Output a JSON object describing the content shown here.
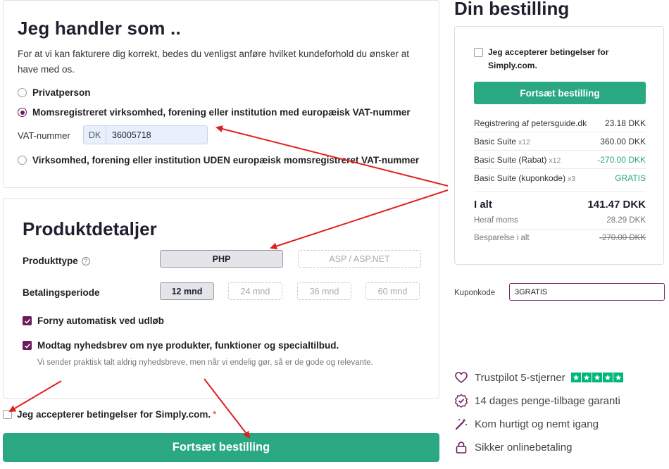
{
  "customer": {
    "title": "Jeg handler som ..",
    "description": "For at vi kan fakturere dig korrekt, bedes du venligst anføre hvilket kundeforhold du ønsker at have med os.",
    "options": [
      {
        "label": "Privatperson",
        "selected": false
      },
      {
        "label": "Momsregistreret virksomhed, forening eller institution med europæisk VAT-nummer",
        "selected": true
      },
      {
        "label": "Virksomhed, forening eller institution UDEN europæisk momsregistreret VAT-nummer",
        "selected": false
      }
    ],
    "vat_label": "VAT-nummer",
    "vat_prefix": "DK",
    "vat_value": "36005718"
  },
  "product": {
    "title": "Produktdetaljer",
    "type_label": "Produkttype",
    "types": [
      "PHP",
      "ASP / ASP.NET"
    ],
    "period_label": "Betalingsperiode",
    "periods": [
      "12 mnd",
      "24 mnd",
      "36 mnd",
      "60 mnd"
    ],
    "renew_label": "Forny automatisk ved udløb",
    "newsletter_label": "Modtag nyhedsbrev om nye produkter, funktioner og specialtilbud.",
    "newsletter_note": "Vi sender praktisk talt aldrig nyhedsbreve, men når vi endelig gør, så er de gode og relevante."
  },
  "accept_terms_label": "Jeg accepterer betingelser for Simply.com.",
  "required_mark": "*",
  "continue_button": "Fortsæt bestilling",
  "order": {
    "title": "Din bestilling",
    "accept_terms_label": "Jeg accepterer betingelser for Simply.com.",
    "continue_button": "Fortsæt bestilling",
    "lines": [
      {
        "name": "Registrering af petersguide.dk",
        "qty": "",
        "price": "23.18 DKK"
      },
      {
        "name": "Basic Suite",
        "qty": "x12",
        "price": "360.00 DKK"
      },
      {
        "name": "Basic Suite (Rabat)",
        "qty": "x12",
        "price": "-270.00 DKK"
      },
      {
        "name": "Basic Suite (kuponkode)",
        "qty": "x3",
        "price": "GRATIS"
      }
    ],
    "total_label": "I alt",
    "total_value": "141.47 DKK",
    "vat_label": "Heraf moms",
    "vat_value": "28.29 DKK",
    "savings_label": "Besparelse i alt",
    "savings_value": "-270.00 DKK"
  },
  "coupon": {
    "label": "Kuponkode",
    "value": "3GRATIS"
  },
  "features": [
    {
      "icon": "heart-icon",
      "label": "Trustpilot 5-stjerner"
    },
    {
      "icon": "badge-check-icon",
      "label": "14 dages penge-tilbage garanti"
    },
    {
      "icon": "magic-wand-icon",
      "label": "Kom hurtigt og nemt igang"
    },
    {
      "icon": "lock-icon",
      "label": "Sikker onlinebetaling"
    }
  ],
  "colors": {
    "accent": "#2aa882",
    "brand_purple": "#6b1b5e",
    "trustpilot": "#00b67a",
    "annotation_arrow": "#e02020"
  }
}
